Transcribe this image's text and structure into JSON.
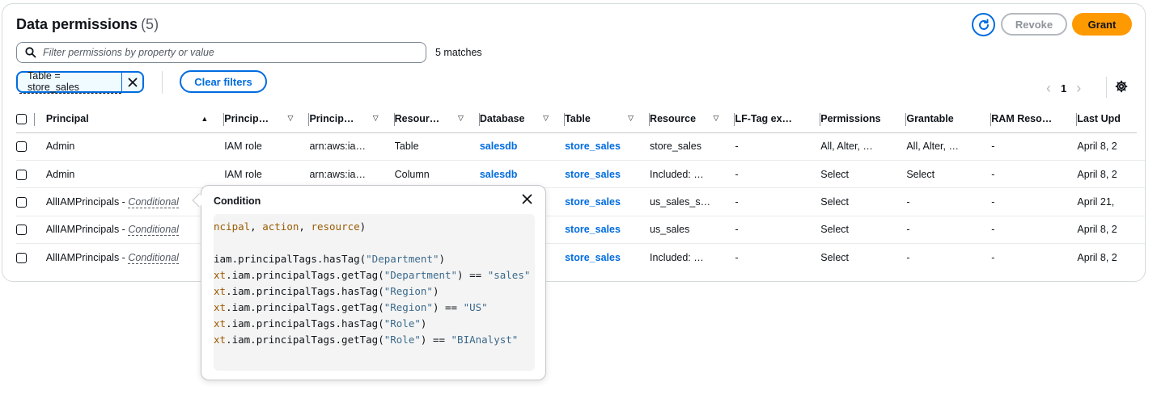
{
  "header": {
    "title": "Data permissions",
    "count": "(5)"
  },
  "buttons": {
    "revoke": "Revoke",
    "grant": "Grant",
    "clear_filters": "Clear filters"
  },
  "filter": {
    "placeholder": "Filter permissions by property or value",
    "matches": "5 matches",
    "token": "Table = store_sales"
  },
  "pagination": {
    "current_page": "1"
  },
  "columns": [
    "Principal",
    "Princip…",
    "Princip…",
    "Resour…",
    "Database",
    "Table",
    "Resource",
    "LF-Tag ex…",
    "Permissions",
    "Grantable",
    "RAM Reso…",
    "Last Upd"
  ],
  "rows": [
    {
      "principal": "Admin",
      "conditional": "",
      "principal_type": "IAM role",
      "principal_arn": "arn:aws:ia…",
      "resource_type": "Table",
      "database": "salesdb",
      "table": "store_sales",
      "resource": "store_sales",
      "lf_tag": "-",
      "permissions": "All, Alter, …",
      "grantable": "All, Alter, …",
      "ram": "-",
      "last_updated": "April 8, 2"
    },
    {
      "principal": "Admin",
      "conditional": "",
      "principal_type": "IAM role",
      "principal_arn": "arn:aws:ia…",
      "resource_type": "Column",
      "database": "salesdb",
      "table": "store_sales",
      "resource": "Included: …",
      "lf_tag": "-",
      "permissions": "Select",
      "grantable": "Select",
      "ram": "-",
      "last_updated": "April 8, 2"
    },
    {
      "principal": "AllIAMPrincipals - ",
      "conditional": "Conditional",
      "principal_type": "",
      "principal_arn": "",
      "resource_type": "",
      "database": "",
      "table": "store_sales",
      "resource": "us_sales_s…",
      "lf_tag": "-",
      "permissions": "Select",
      "grantable": "-",
      "ram": "-",
      "last_updated": "April 21,"
    },
    {
      "principal": "AllIAMPrincipals - ",
      "conditional": "Conditional",
      "principal_type": "",
      "principal_arn": "",
      "resource_type": "",
      "database": "",
      "table": "store_sales",
      "resource": "us_sales",
      "lf_tag": "-",
      "permissions": "Select",
      "grantable": "-",
      "ram": "-",
      "last_updated": "April 8, 2"
    },
    {
      "principal": "AllIAMPrincipals - ",
      "conditional": "Conditional",
      "principal_type": "",
      "principal_arn": "",
      "resource_type": "",
      "database": "",
      "table": "store_sales",
      "resource": "Included: …",
      "lf_tag": "-",
      "permissions": "Select",
      "grantable": "-",
      "ram": "-",
      "last_updated": "April 8, 2"
    }
  ],
  "popover": {
    "title": "Condition",
    "code_lines": [
      [
        {
          "t": "ncipal",
          "c": "kw"
        },
        {
          "t": ", ",
          "c": ""
        },
        {
          "t": "action",
          "c": "kw"
        },
        {
          "t": ", ",
          "c": ""
        },
        {
          "t": "resource",
          "c": "kw"
        },
        {
          "t": ")",
          "c": ""
        }
      ],
      [],
      [
        {
          "t": "iam.principalTags.hasTag(",
          "c": ""
        },
        {
          "t": "\"Department\"",
          "c": "str"
        },
        {
          "t": ")",
          "c": ""
        }
      ],
      [
        {
          "t": "xt",
          "c": "kw"
        },
        {
          "t": ".iam.principalTags.getTag(",
          "c": ""
        },
        {
          "t": "\"Department\"",
          "c": "str"
        },
        {
          "t": ") == ",
          "c": ""
        },
        {
          "t": "\"sales\"",
          "c": "str"
        }
      ],
      [
        {
          "t": "xt",
          "c": "kw"
        },
        {
          "t": ".iam.principalTags.hasTag(",
          "c": ""
        },
        {
          "t": "\"Region\"",
          "c": "str"
        },
        {
          "t": ")",
          "c": ""
        }
      ],
      [
        {
          "t": "xt",
          "c": "kw"
        },
        {
          "t": ".iam.principalTags.getTag(",
          "c": ""
        },
        {
          "t": "\"Region\"",
          "c": "str"
        },
        {
          "t": ") == ",
          "c": ""
        },
        {
          "t": "\"US\"",
          "c": "str"
        }
      ],
      [
        {
          "t": "xt",
          "c": "kw"
        },
        {
          "t": ".iam.principalTags.hasTag(",
          "c": ""
        },
        {
          "t": "\"Role\"",
          "c": "str"
        },
        {
          "t": ")",
          "c": ""
        }
      ],
      [
        {
          "t": "xt",
          "c": "kw"
        },
        {
          "t": ".iam.principalTags.getTag(",
          "c": ""
        },
        {
          "t": "\"Role\"",
          "c": "str"
        },
        {
          "t": ") == ",
          "c": ""
        },
        {
          "t": "\"BIAnalyst\"",
          "c": "str"
        }
      ]
    ]
  },
  "colors": {
    "accent": "#006ce0",
    "grant": "#ff9900",
    "border": "#d5dbdb"
  }
}
